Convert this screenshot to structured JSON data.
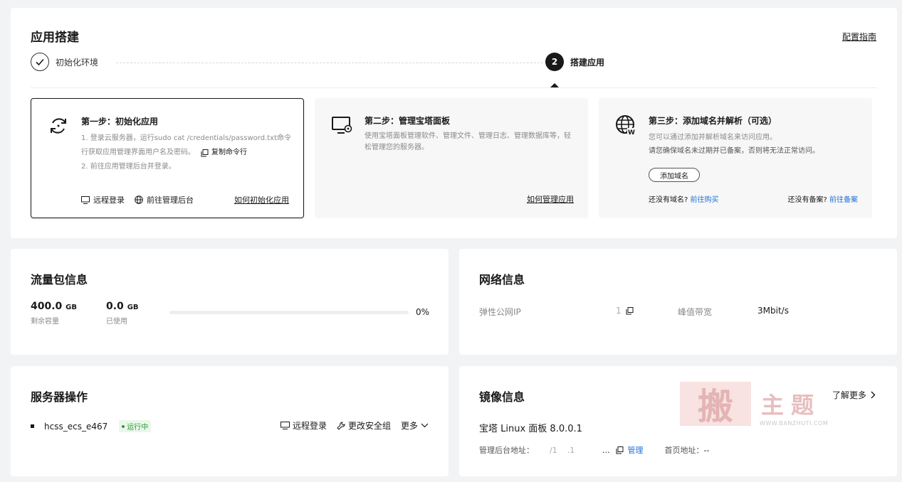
{
  "build": {
    "title": "应用搭建",
    "guide_link": "配置指南",
    "steps": [
      {
        "label": "初始化环境",
        "state": "done"
      },
      {
        "number": "2",
        "label": "搭建应用",
        "state": "active"
      }
    ],
    "cards": [
      {
        "title": "第一步：初始化应用",
        "line1": "1. 登录云服务器，运行sudo cat /credentials/password.txt命令",
        "line2": "行获取应用管理界面用户名及密码。",
        "copy_label": "复制命令行",
        "line3": "2. 前往应用管理后台并登录。",
        "remote_login": "远程登录",
        "goto_admin": "前往管理后台",
        "howto": "如何初始化应用"
      },
      {
        "title": "第二步：管理宝塔面板",
        "desc": "使用宝塔面板管理软件、管理文件、管理日志、管理数据库等，轻松管理您的服务器。",
        "howto": "如何管理应用"
      },
      {
        "title": "第三步：添加域名并解析（可选）",
        "line1": "您可以通过添加并解析域名来访问应用。",
        "line2": "请您确保域名未过期并已备案，否则将无法正常访问。",
        "add_domain": "添加域名",
        "no_domain": "还没有域名?",
        "buy": "前往购买",
        "no_record": "还没有备案?",
        "record": "前往备案"
      }
    ]
  },
  "traffic": {
    "title": "流量包信息",
    "remaining_value": "400.0",
    "remaining_unit": "GB",
    "remaining_label": "剩余容量",
    "used_value": "0.0",
    "used_unit": "GB",
    "used_label": "已使用",
    "percent": "0%",
    "percent_value": 0
  },
  "network": {
    "title": "网络信息",
    "ip_label": "弹性公网IP",
    "ip_value": "1",
    "bandwidth_label": "峰值带宽",
    "bandwidth_value": "3Mbit/s"
  },
  "server": {
    "title": "服务器操作",
    "name": "hcss_ecs_e467",
    "status": "运行中",
    "remote_login": "远程登录",
    "change_sg": "更改安全组",
    "more": "更多"
  },
  "image": {
    "title": "镜像信息",
    "learn_more": "了解更多",
    "os": "宝塔 Linux 面板 8.0.0.1",
    "admin_label": "管理后台地址：",
    "admin_value": "/1    .1",
    "ellipsis": "...",
    "manage": "管理",
    "home_label": "首页地址：",
    "home_value": "--",
    "watermark_char": "搬",
    "watermark_text": "主题",
    "watermark_url": "WWW.BANZHUTI.COM"
  },
  "colors": {
    "accent": "#1f6fd6",
    "running": "#2c9c3c",
    "background": "#f2f3f5"
  }
}
